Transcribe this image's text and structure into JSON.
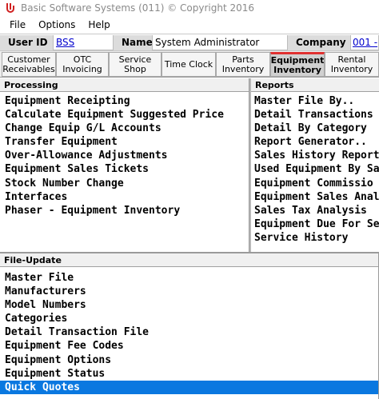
{
  "window": {
    "title": "Basic Software Systems (011) © Copyright 2016",
    "icon": "bss-logo-icon"
  },
  "menu": {
    "items": [
      "File",
      "Options",
      "Help"
    ]
  },
  "info_bar": {
    "user_id_label": "User ID",
    "user_id_value": "BSS",
    "name_label": "Name",
    "name_value": "System Administrator",
    "company_label": "Company",
    "company_value": "001 -"
  },
  "tabs": [
    {
      "label": "Customer\nReceivables",
      "active": false
    },
    {
      "label": "OTC\nInvoicing",
      "active": false
    },
    {
      "label": "Service\nShop",
      "active": false
    },
    {
      "label": "Time Clock",
      "active": false
    },
    {
      "label": "Parts\nInventory",
      "active": false
    },
    {
      "label": "Equipment\nInventory",
      "active": true
    },
    {
      "label": "Rental\nInventory",
      "active": false
    }
  ],
  "processing": {
    "header": "Processing",
    "items": [
      "Equipment Receipting",
      "Calculate Equipment Suggested Price",
      "Change Equip G/L Accounts",
      "Transfer Equipment",
      "Over-Allowance Adjustments",
      "Equipment Sales Tickets",
      "Stock Number Change",
      "Interfaces",
      "Phaser - Equipment Inventory"
    ]
  },
  "reports": {
    "header": "Reports",
    "items": [
      "Master File By..",
      "Detail Transactions In",
      "Detail By Category",
      "Report Generator..",
      "Sales History Report C",
      "Used Equipment By Sa",
      "Equipment Commissio",
      "Equipment Sales Anal",
      "Sales Tax Analysis",
      "Equipment Due For Se",
      "Service History"
    ]
  },
  "file_update": {
    "header": "File-Update",
    "items": [
      "Master File",
      "Manufacturers",
      "Model Numbers",
      "Categories",
      "Detail Transaction File",
      "Equipment Fee Codes",
      "Equipment Options",
      "Equipment Status",
      "Quick Quotes"
    ],
    "selected_index": 8
  },
  "colors": {
    "selection": "#0a78e0",
    "active_tab_accent": "#e03030",
    "link": "#0000cc"
  }
}
